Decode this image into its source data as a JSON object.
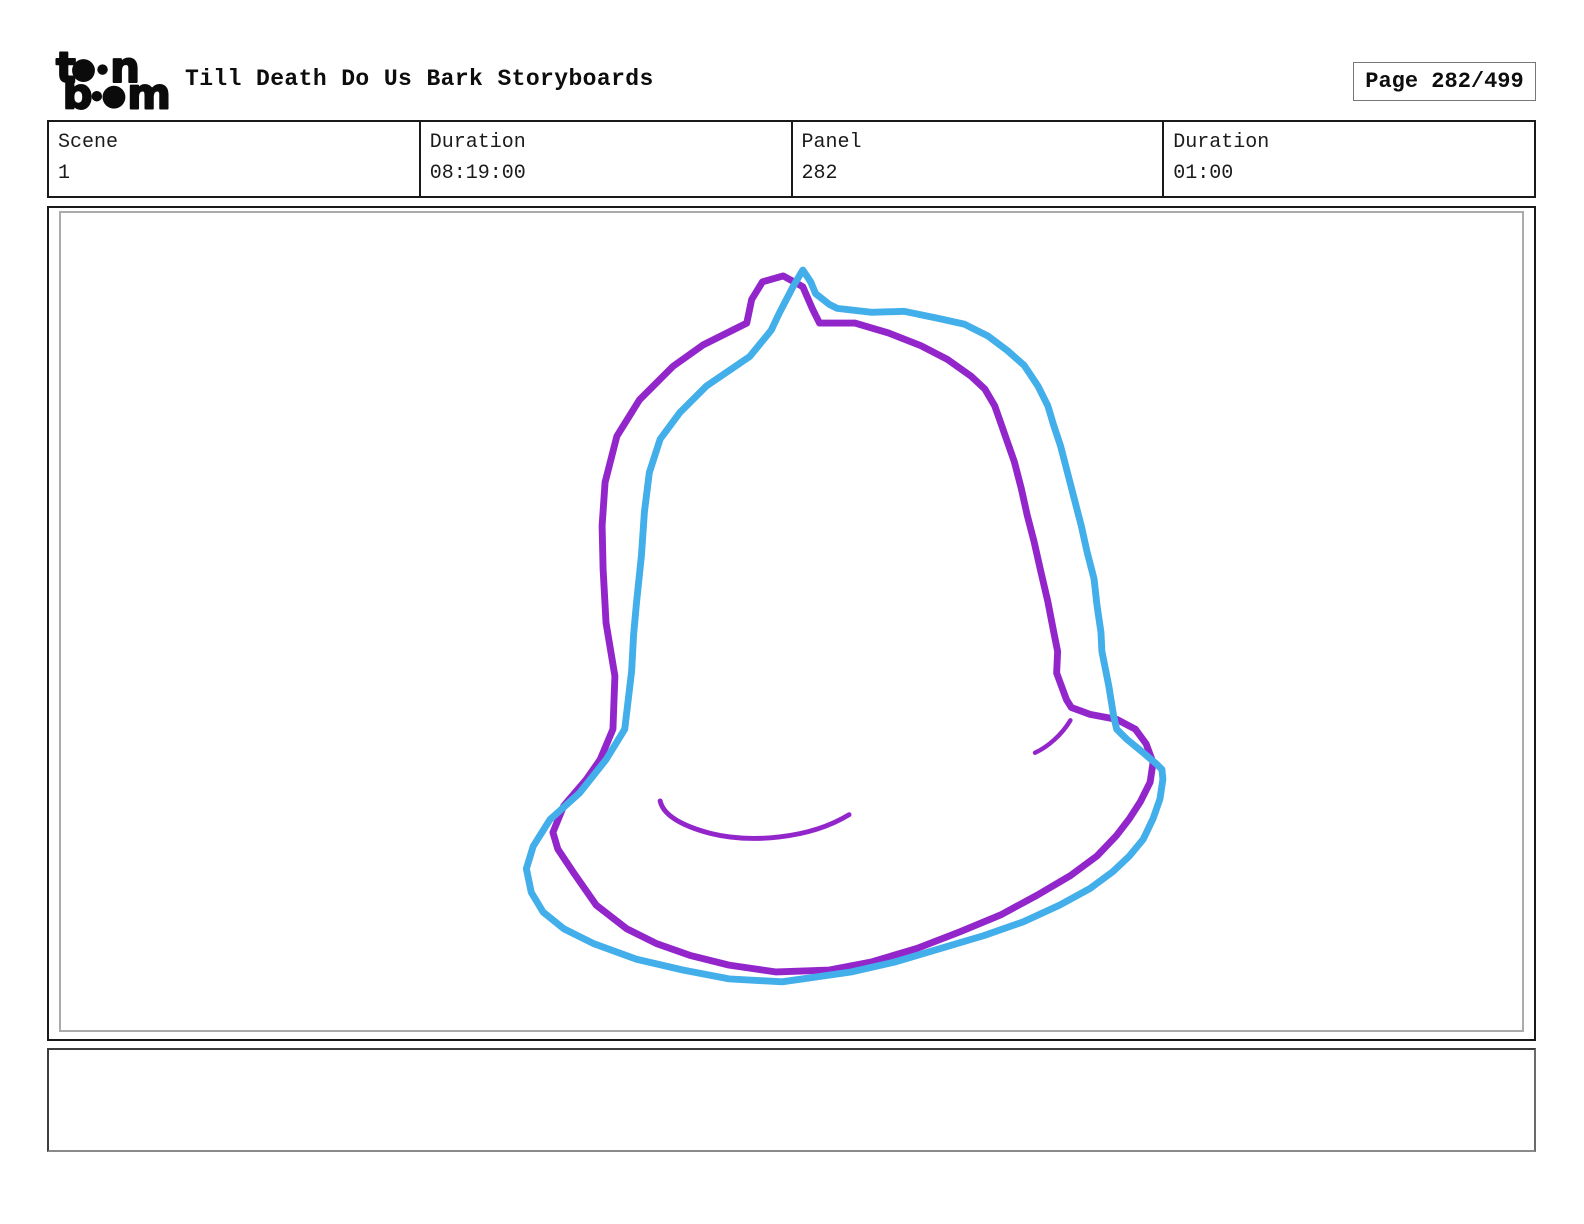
{
  "header": {
    "logo": {
      "alt": "toon boom",
      "l1_t": "t",
      "l1_n": "n",
      "l2_b": "b",
      "l2_m": "m"
    },
    "title": "Till Death Do Us Bark Storyboards",
    "page_label": "Page 282/499"
  },
  "info_row": {
    "cells": [
      {
        "label": "Scene",
        "value": "1"
      },
      {
        "label": "Duration",
        "value": "08:19:00"
      },
      {
        "label": "Panel",
        "value": "282"
      },
      {
        "label": "Duration",
        "value": "01:00"
      }
    ]
  },
  "panel": {
    "sketch": {
      "description": "hand-drawn bell outline sketched twice (onion-skin style) with small shading strokes",
      "blue_color": "#42aeea",
      "purple_color": "#9326cb"
    }
  },
  "caption": {
    "text": ""
  }
}
